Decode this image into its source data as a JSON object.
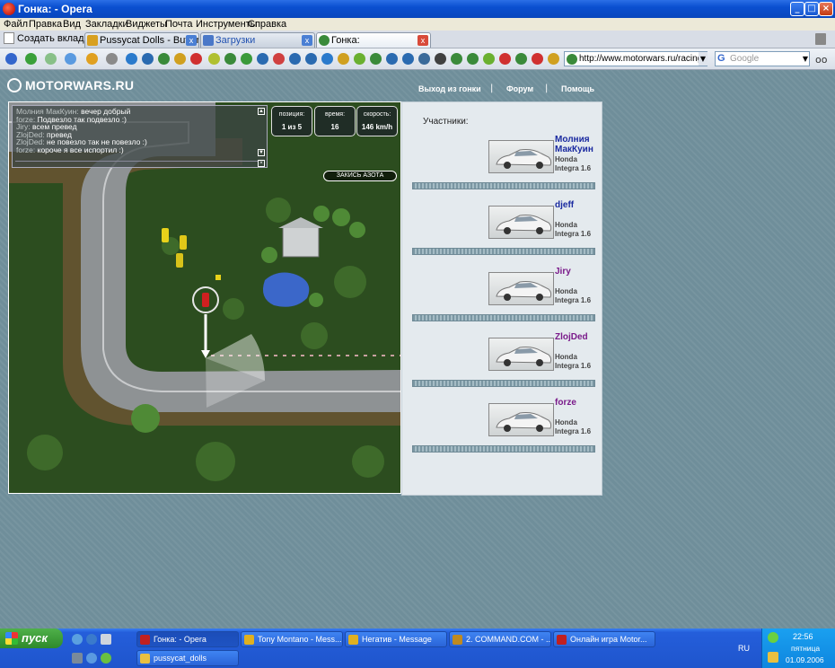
{
  "window": {
    "title": "Гонка: - Opera"
  },
  "menu": [
    "Файл",
    "Правка",
    "Вид",
    "Закладки",
    "Виджеты",
    "Почта",
    "Инструменты",
    "Справка"
  ],
  "tabs": {
    "new_tab": "Создать вкладку",
    "items": [
      {
        "label": "Pussycat Dolls - Buttons ..."
      },
      {
        "label": "Загрузки"
      },
      {
        "label": "Гонка:",
        "active": true
      }
    ]
  },
  "toolbar": {
    "address": "http://www.motorwars.ru/racing.php",
    "search_placeholder": "Google"
  },
  "site": {
    "logo": "MOTORWARS.RU",
    "nav": [
      "Выход из гонки",
      "Форум",
      "Помощь"
    ],
    "separator": "|"
  },
  "race": {
    "chat": [
      {
        "nick": "Молния МакКуин:",
        "text": "вечер добрый"
      },
      {
        "nick": "forze:",
        "text": "Подвезло так подвезло :)"
      },
      {
        "nick": "Jiry:",
        "text": "всем превед"
      },
      {
        "nick": "ZlojDed:",
        "text": "превед"
      },
      {
        "nick": "ZlojDed:",
        "text": "не повезло так не повезло :)"
      },
      {
        "nick": "forze:",
        "text": "короче я все испортил :)"
      }
    ],
    "stats": [
      {
        "label": "позиция:",
        "value": "1 из 5"
      },
      {
        "label": "время:",
        "value": "16"
      },
      {
        "label": "скорость:",
        "value": "146 km/h"
      }
    ],
    "nitro_button": "ЗАКИСЬ АЗОТА"
  },
  "participants": {
    "label": "Участники:",
    "items": [
      {
        "name": "Молния МакКуин",
        "model": "Honda Integra 1.6",
        "color": "#1a2aa0"
      },
      {
        "name": "djeff",
        "model": "Honda Integra 1.6",
        "color": "#1a2aa0"
      },
      {
        "name": "Jiry",
        "model": "Honda Integra 1.6",
        "color": "#7a1a8a"
      },
      {
        "name": "ZlojDed",
        "model": "Honda Integra 1.6",
        "color": "#7a1a8a"
      },
      {
        "name": "forze",
        "model": "Honda Integra 1.6",
        "color": "#7a1a8a"
      }
    ]
  },
  "taskbar": {
    "start": "пуск",
    "tasks": [
      {
        "label": "Гонка: - Opera",
        "active": true
      },
      {
        "label": "Tony Montano - Mess..."
      },
      {
        "label": "Негатив - Message"
      },
      {
        "label": "2. COMMAND.COM - ..."
      },
      {
        "label": "Онлайн игра Motor..."
      },
      {
        "label": "pussycat_dolls"
      }
    ],
    "lang": "RU",
    "clock": "22:56",
    "day": "пятница",
    "date": "01.09.2006"
  }
}
